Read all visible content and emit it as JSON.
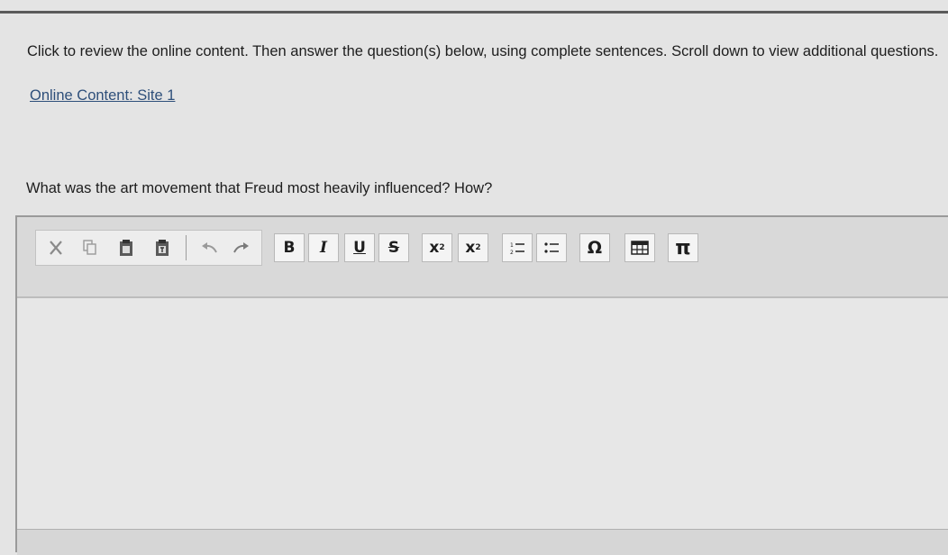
{
  "instructions": "Click to review the online content. Then answer the question(s) below, using complete sentences. Scroll down to view additional questions.",
  "online_content_link": "Online Content: Site 1",
  "question": "What was the art movement that Freud most heavily influenced? How?",
  "toolbar": {
    "bold": "B",
    "italic": "I",
    "underline": "U",
    "strikethrough": "S",
    "subscript_base": "x",
    "subscript_sub": "2",
    "superscript_base": "x",
    "superscript_sup": "2",
    "special_char": "Ω",
    "pi": "π"
  },
  "answer_text": ""
}
